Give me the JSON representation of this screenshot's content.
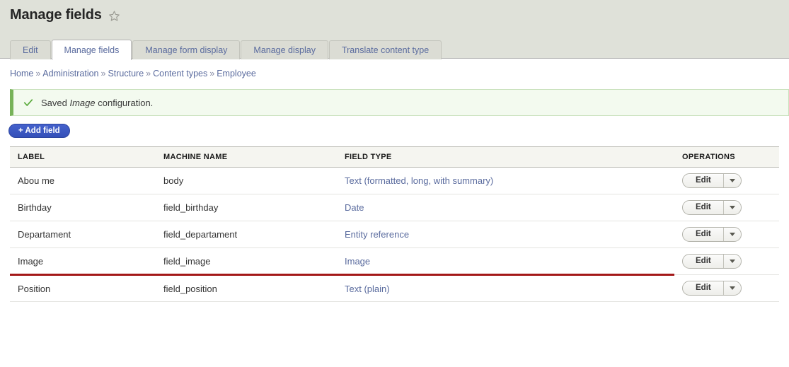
{
  "page": {
    "title": "Manage fields",
    "favorite_icon": "star-outline-icon"
  },
  "tabs": [
    {
      "label": "Edit",
      "active": false
    },
    {
      "label": "Manage fields",
      "active": true
    },
    {
      "label": "Manage form display",
      "active": false
    },
    {
      "label": "Manage display",
      "active": false
    },
    {
      "label": "Translate content type",
      "active": false
    }
  ],
  "breadcrumb": {
    "separator": "»",
    "items": [
      "Home",
      "Administration",
      "Structure",
      "Content types",
      "Employee"
    ]
  },
  "status_message": {
    "icon": "check-icon",
    "prefix": "Saved ",
    "emphasis": "Image",
    "suffix": " configuration.",
    "accent_color": "#77b259",
    "background_color": "#f3faef"
  },
  "actions": {
    "add_field_label": "+ Add field",
    "add_field_color": "#3b59c3"
  },
  "table": {
    "columns": [
      "LABEL",
      "MACHINE NAME",
      "FIELD TYPE",
      "OPERATIONS"
    ],
    "highlight_color": "#a31818",
    "rows": [
      {
        "label": "Abou me",
        "machine_name": "body",
        "field_type": "Text (formatted, long, with summary)",
        "operation_label": "Edit",
        "highlighted": false
      },
      {
        "label": "Birthday",
        "machine_name": "field_birthday",
        "field_type": "Date",
        "operation_label": "Edit",
        "highlighted": false
      },
      {
        "label": "Departament",
        "machine_name": "field_departament",
        "field_type": "Entity reference",
        "operation_label": "Edit",
        "highlighted": false
      },
      {
        "label": "Image",
        "machine_name": "field_image",
        "field_type": "Image",
        "operation_label": "Edit",
        "highlighted": true
      },
      {
        "label": "Position",
        "machine_name": "field_position",
        "field_type": "Text (plain)",
        "operation_label": "Edit",
        "highlighted": false
      }
    ]
  }
}
